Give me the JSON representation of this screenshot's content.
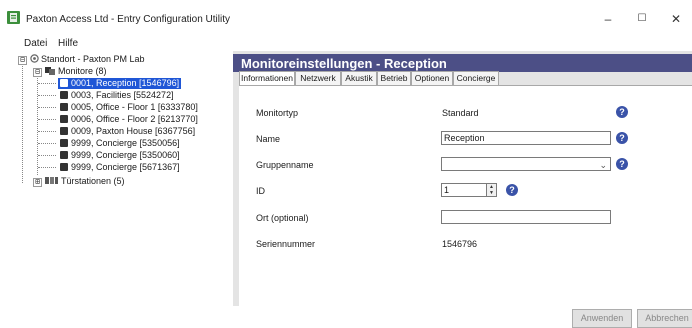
{
  "window": {
    "title": "Paxton Access Ltd - Entry Configuration Utility",
    "icon": "paxton-app-icon",
    "controls": {
      "minimize": "–",
      "maximize": "☐",
      "close": "✕"
    }
  },
  "menu": {
    "items": [
      {
        "label": "Datei"
      },
      {
        "label": "Hilfe"
      }
    ]
  },
  "tree": {
    "root": {
      "label": "Standort - Paxton PM Lab",
      "expander": "⊟"
    },
    "monitore": {
      "label": "Monitore (8)",
      "expander": "⊟"
    },
    "monitors": [
      {
        "label": "0001, Reception [1546796]",
        "selected": true
      },
      {
        "label": "0003, Facilities [5524272]"
      },
      {
        "label": "0005, Office - Floor 1 [6333780]"
      },
      {
        "label": "0006, Office - Floor 2 [6213770]"
      },
      {
        "label": "0009, Paxton House [6367756]"
      },
      {
        "label": "9999, Concierge [5350056]"
      },
      {
        "label": "9999, Concierge [5350060]"
      },
      {
        "label": "9999, Concierge [5671367]"
      }
    ],
    "tuerstationen": {
      "label": "Türstationen (5)",
      "expander": "⊞"
    }
  },
  "panel": {
    "title": "Monitoreinstellungen - Reception",
    "tabs": [
      {
        "label": "Informationen",
        "active": true
      },
      {
        "label": "Netzwerk"
      },
      {
        "label": "Akustik"
      },
      {
        "label": "Betrieb"
      },
      {
        "label": "Optionen"
      },
      {
        "label": "Concierge"
      }
    ],
    "fields": {
      "monitortyp": {
        "label": "Monitortyp",
        "value": "Standard"
      },
      "name": {
        "label": "Name",
        "value": "Reception"
      },
      "gruppenname": {
        "label": "Gruppenname",
        "value": "",
        "arrow": "⌄"
      },
      "id": {
        "label": "ID",
        "value": "1",
        "spin_up": "▲",
        "spin_down": "▼"
      },
      "ort": {
        "label": "Ort (optional)",
        "value": ""
      },
      "seriennummer": {
        "label": "Seriennummer",
        "value": "1546796"
      }
    },
    "help_glyph": "?",
    "buttons": {
      "apply": "Anwenden",
      "cancel": "Abbrechen"
    }
  },
  "colors": {
    "panel_header": "#4c4f86",
    "selection": "#1f56d6",
    "help_icon": "#3a53a8",
    "panel_bg": "#e4e4e4"
  }
}
